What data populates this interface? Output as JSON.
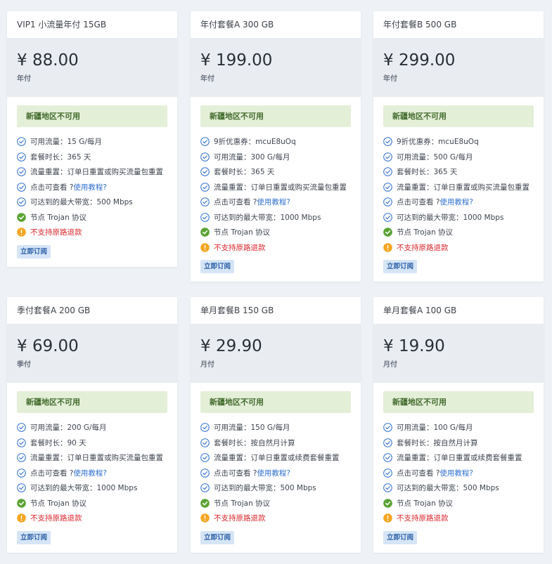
{
  "accent_color": "#2f6fce",
  "warn_color": "#d9262c",
  "ok_color": "#5aa333",
  "plans": [
    {
      "title": "VIP1 小流量年付 15GB",
      "price": "¥ 88.00",
      "period": "年付",
      "notice": "新疆地区不可用",
      "features": [
        {
          "type": "check",
          "text": "可用流量：15 G/每月"
        },
        {
          "type": "check",
          "text": "套餐时长：365 天"
        },
        {
          "type": "check",
          "text": "流量重置：订单日重置或购买流量包重置"
        },
        {
          "type": "check",
          "text": "点击可查看 ?",
          "link": "使用教程?"
        },
        {
          "type": "check",
          "text": "可达到的最大带宽：500 Mbps"
        },
        {
          "type": "ok",
          "text": "节点 Trojan 协议"
        },
        {
          "type": "warn",
          "text": "不支持原路退款"
        }
      ],
      "button": "立即订阅"
    },
    {
      "title": "年付套餐A 300 GB",
      "price": "¥ 199.00",
      "period": "年付",
      "notice": "新疆地区不可用",
      "features": [
        {
          "type": "check",
          "text": "9折优惠券：mcuE8uOq"
        },
        {
          "type": "check",
          "text": "可用流量：300 G/每月"
        },
        {
          "type": "check",
          "text": "套餐时长：365 天"
        },
        {
          "type": "check",
          "text": "流量重置：订单日重置或购买流量包重置"
        },
        {
          "type": "check",
          "text": "点击可查看 ?",
          "link": "使用教程?"
        },
        {
          "type": "check",
          "text": "可达到的最大带宽：1000 Mbps"
        },
        {
          "type": "ok",
          "text": "节点 Trojan 协议"
        },
        {
          "type": "warn",
          "text": "不支持原路退款"
        }
      ],
      "button": "立即订阅"
    },
    {
      "title": "年付套餐B 500 GB",
      "price": "¥ 299.00",
      "period": "年付",
      "notice": "新疆地区不可用",
      "features": [
        {
          "type": "check",
          "text": "9折优惠券：mcuE8uOq"
        },
        {
          "type": "check",
          "text": "可用流量：500 G/每月"
        },
        {
          "type": "check",
          "text": "套餐时长：365 天"
        },
        {
          "type": "check",
          "text": "流量重置：订单日重置或购买流量包重置"
        },
        {
          "type": "check",
          "text": "点击可查看 ?",
          "link": "使用教程?"
        },
        {
          "type": "check",
          "text": "可达到的最大带宽：1000 Mbps"
        },
        {
          "type": "ok",
          "text": "节点 Trojan 协议"
        },
        {
          "type": "warn",
          "text": "不支持原路退款"
        }
      ],
      "button": "立即订阅"
    },
    {
      "title": "季付套餐A 200 GB",
      "price": "¥ 69.00",
      "period": "季付",
      "notice": "新疆地区不可用",
      "features": [
        {
          "type": "check",
          "text": "可用流量：200 G/每月"
        },
        {
          "type": "check",
          "text": "套餐时长：90 天"
        },
        {
          "type": "check",
          "text": "流量重置：订单日重置或购买流量包重置"
        },
        {
          "type": "check",
          "text": "点击可查看 ?",
          "link": "使用教程?"
        },
        {
          "type": "check",
          "text": "可达到的最大带宽：1000 Mbps"
        },
        {
          "type": "ok",
          "text": "节点 Trojan 协议"
        },
        {
          "type": "warn",
          "text": "不支持原路退款"
        }
      ],
      "button": "立即订阅"
    },
    {
      "title": "单月套餐B 150 GB",
      "price": "¥ 29.90",
      "period": "月付",
      "notice": "新疆地区不可用",
      "features": [
        {
          "type": "check",
          "text": "可用流量：150 G/每月"
        },
        {
          "type": "check",
          "text": "套餐时长：按自然月计算"
        },
        {
          "type": "check",
          "text": "流量重置：订单日重置或续费套餐重置"
        },
        {
          "type": "check",
          "text": "点击可查看 ?",
          "link": "使用教程?"
        },
        {
          "type": "check",
          "text": "可达到的最大带宽：500 Mbps"
        },
        {
          "type": "ok",
          "text": "节点 Trojan 协议"
        },
        {
          "type": "warn",
          "text": "不支持原路退款"
        }
      ],
      "button": "立即订阅"
    },
    {
      "title": "单月套餐A 100 GB",
      "price": "¥ 19.90",
      "period": "月付",
      "notice": "新疆地区不可用",
      "features": [
        {
          "type": "check",
          "text": "可用流量：100 G/每月"
        },
        {
          "type": "check",
          "text": "套餐时长：按自然月计算"
        },
        {
          "type": "check",
          "text": "流量重置：订单日重置或续费套餐重置"
        },
        {
          "type": "check",
          "text": "点击可查看 ?",
          "link": "使用教程?"
        },
        {
          "type": "check",
          "text": "可达到的最大带宽：500 Mbps"
        },
        {
          "type": "ok",
          "text": "节点 Trojan 协议"
        },
        {
          "type": "warn",
          "text": "不支持原路退款"
        }
      ],
      "button": "立即订阅"
    }
  ]
}
